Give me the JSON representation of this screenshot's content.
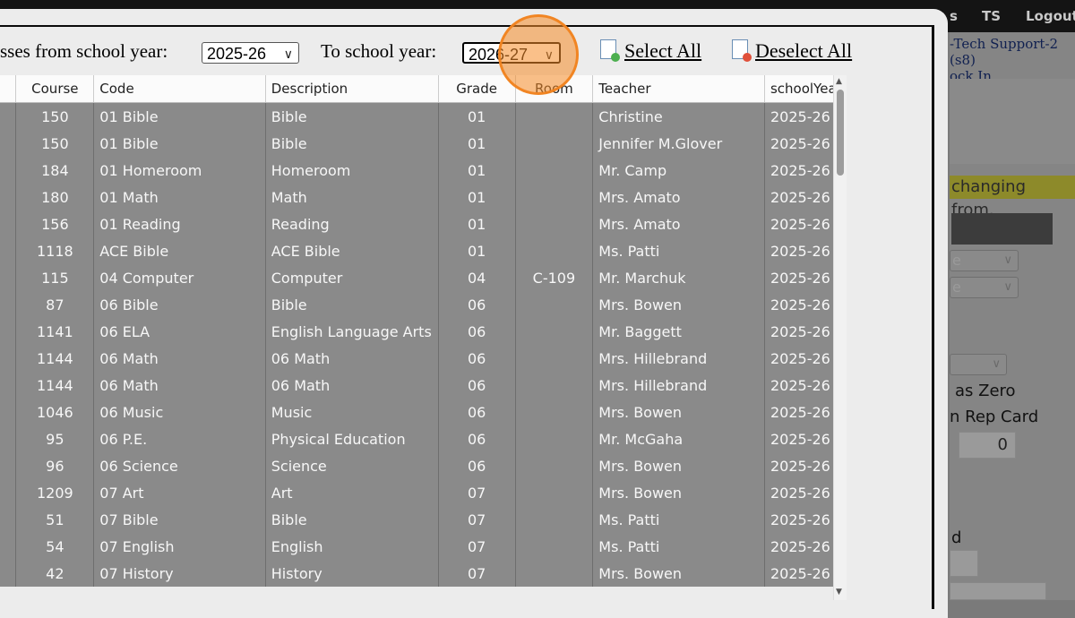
{
  "background": {
    "nav": [
      "s",
      "TS",
      "Logout"
    ],
    "user_line": "-Tech Support-2 (s8)",
    "user_link": "ock In",
    "highlight_text": "changing from.",
    "select_partial": "e",
    "treat_zero_text": "as Zero",
    "rep_card_text": "n Rep Card",
    "zero_value": "0",
    "d_text": "d"
  },
  "toolbar": {
    "from_label": "sses from school year:",
    "from_value": "2025-26",
    "to_label": "To school year:",
    "to_value": "2026-27",
    "select_all": "Select All",
    "deselect_all": "Deselect All"
  },
  "colors": {
    "row_bg": "#8a8a8a",
    "header_bg": "#fbfbfb",
    "accent_ring": "#f0821e",
    "select_icon_dot": "#4caf50",
    "deselect_icon_dot": "#e0503a"
  },
  "table": {
    "headers": [
      "",
      "Course",
      "Code",
      "Description",
      "Grade",
      "Room",
      "Teacher",
      "schoolYea"
    ],
    "rows": [
      [
        "",
        "150",
        "01 Bible",
        "Bible",
        "01",
        "",
        "Christine",
        "2025-26"
      ],
      [
        "",
        "150",
        "01 Bible",
        "Bible",
        "01",
        "",
        "Jennifer M.Glover",
        "2025-26"
      ],
      [
        "",
        "184",
        "01 Homeroom",
        "Homeroom",
        "01",
        "",
        "Mr. Camp",
        "2025-26"
      ],
      [
        "",
        "180",
        "01 Math",
        "Math",
        "01",
        "",
        "Mrs. Amato",
        "2025-26"
      ],
      [
        "",
        "156",
        "01 Reading",
        "Reading",
        "01",
        "",
        "Mrs. Amato",
        "2025-26"
      ],
      [
        "",
        "1118",
        "ACE Bible",
        "ACE Bible",
        "01",
        "",
        "Ms. Patti",
        "2025-26"
      ],
      [
        "",
        "115",
        "04 Computer",
        "Computer",
        "04",
        "C-109",
        "Mr. Marchuk",
        "2025-26"
      ],
      [
        "",
        "87",
        "06 Bible",
        "Bible",
        "06",
        "",
        "Mrs. Bowen",
        "2025-26"
      ],
      [
        "",
        "1141",
        "06 ELA",
        "English Language Arts",
        "06",
        "",
        "Mr. Baggett",
        "2025-26"
      ],
      [
        "",
        "1144",
        "06 Math",
        "06 Math",
        "06",
        "",
        "Mrs. Hillebrand",
        "2025-26"
      ],
      [
        "",
        "1144",
        "06 Math",
        "06 Math",
        "06",
        "",
        "Mrs. Hillebrand",
        "2025-26"
      ],
      [
        "",
        "1046",
        "06 Music",
        "Music",
        "06",
        "",
        "Mrs. Bowen",
        "2025-26"
      ],
      [
        "",
        "95",
        "06 P.E.",
        "Physical Education",
        "06",
        "",
        "Mr. McGaha",
        "2025-26"
      ],
      [
        "",
        "96",
        "06 Science",
        "Science",
        "06",
        "",
        "Mrs. Bowen",
        "2025-26"
      ],
      [
        "",
        "1209",
        "07 Art",
        "Art",
        "07",
        "",
        "Mrs. Bowen",
        "2025-26"
      ],
      [
        "",
        "51",
        "07 Bible",
        "Bible",
        "07",
        "",
        "Ms. Patti",
        "2025-26"
      ],
      [
        "",
        "54",
        "07 English",
        "English",
        "07",
        "",
        "Ms. Patti",
        "2025-26"
      ],
      [
        "",
        "42",
        "07 History",
        "History",
        "07",
        "",
        "Mrs. Bowen",
        "2025-26"
      ]
    ]
  }
}
